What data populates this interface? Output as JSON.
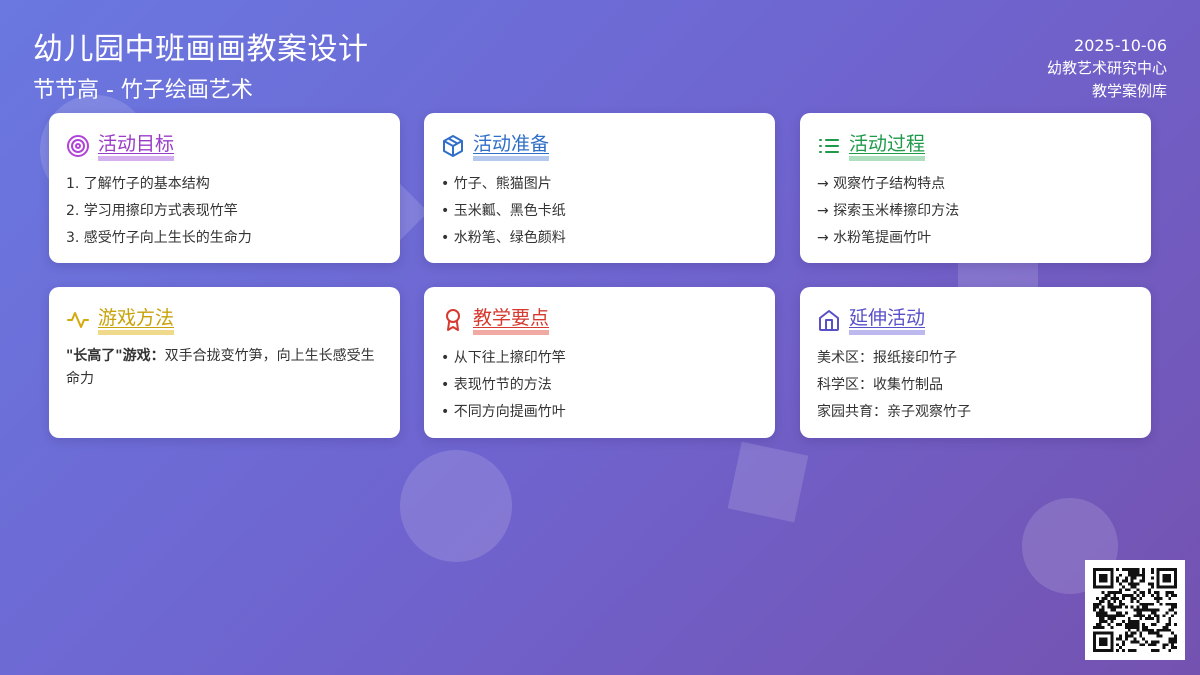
{
  "header": {
    "title": "幼儿园中班画画教案设计",
    "subtitle": "节节高 - 竹子绘画艺术",
    "date": "2025-10-06",
    "org": "幼教艺术研究中心",
    "library": "教学案例库"
  },
  "cards": [
    {
      "title": "活动目标",
      "icon": "target-icon",
      "color": "#9b3cc9",
      "underline": "#d6b0ee",
      "items": [
        "1. 了解竹子的基本结构",
        "2. 学习用擦印方式表现竹竿",
        "3. 感受竹子向上生长的生命力"
      ]
    },
    {
      "title": "活动准备",
      "icon": "box-icon",
      "color": "#2f6fc8",
      "underline": "#b5c8ee",
      "items": [
        "• 竹子、熊猫图片",
        "• 玉米瓤、黑色卡纸",
        "• 水粉笔、绿色颜料"
      ]
    },
    {
      "title": "活动过程",
      "icon": "list-icon",
      "color": "#1f9a4a",
      "underline": "#aee0bf",
      "items": [
        "→ 观察竹子结构特点",
        "→ 探索玉米棒擦印方法",
        "→ 水粉笔提画竹叶"
      ]
    },
    {
      "title": "游戏方法",
      "icon": "activity-icon",
      "color": "#c9a20a",
      "underline": "#efd98a",
      "bold_text": "\"长高了\"游戏：",
      "text": "双手合拢变竹笋，向上生长感受生命力"
    },
    {
      "title": "教学要点",
      "icon": "award-icon",
      "color": "#d63a2f",
      "underline": "#f0aaa3",
      "items": [
        "• 从下往上擦印竹竿",
        "• 表现竹节的方法",
        "• 不同方向提画竹叶"
      ]
    },
    {
      "title": "延伸活动",
      "icon": "home-icon",
      "color": "#5850c8",
      "underline": "#bdb8ee",
      "items": [
        "美术区：报纸接印竹子",
        "科学区：收集竹制品",
        "家园共育：亲子观察竹子"
      ]
    }
  ]
}
